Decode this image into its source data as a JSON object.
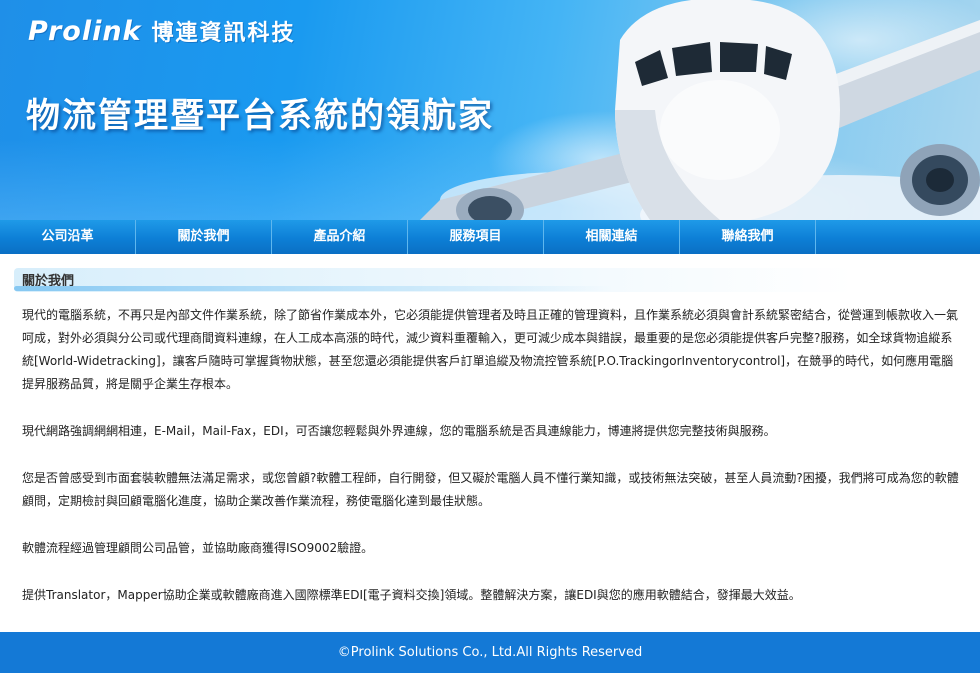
{
  "brand": {
    "logo_text": "Prolink",
    "company_name": "博連資訊科技",
    "slogan": "物流管理暨平台系統的領航家"
  },
  "nav": {
    "items": [
      "公司沿革",
      "關於我們",
      "產品介紹",
      "服務項目",
      "相關連結",
      "聯絡我們"
    ]
  },
  "section": {
    "title": "關於我們"
  },
  "content": {
    "paragraphs": [
      "現代的電腦系統，不再只是內部文件作業系統，除了節省作業成本外，它必須能提供管理者及時且正確的管理資料，且作業系統必須與會計系統緊密結合，從營運到帳款收入一氣呵成，對外必須與分公司或代理商間資料連線，在人工成本高漲的時代，減少資料重覆輸入，更可減少成本與錯誤，最重要的是您必須能提供客戶完整?服務，如全球貨物追縱系統[World-Widetracking]，讓客戶隨時可掌握貨物狀態，甚至您還必須能提供客戶訂單追縱及物流控管系統[P.O.TrackingorInventorycontrol]，在競爭的時代，如何應用電腦提昇服務品質，將是關乎企業生存根本。",
      "現代網路強調網網相連，E-Mail，Mail-Fax，EDI，可否讓您輕鬆與外界連線，您的電腦系統是否具連線能力，博連將提供您完整技術與服務。",
      "您是否曾感受到市面套裝軟體無法滿足需求，或您曾顧?軟體工程師，自行開發，但又礙於電腦人員不懂行業知識，或技術無法突破，甚至人員流動?困擾，我們將可成為您的軟體顧問，定期檢討與回顧電腦化進度，協助企業改善作業流程，務使電腦化達到最佳狀態。",
      "軟體流程經過管理顧問公司品管，並協助廠商獲得ISO9002驗證。",
      "提供Translator，Mapper協助企業或軟體廠商進入國際標準EDI[電子資料交換]領域。整體解決方案，讓EDI與您的應用軟體結合，發揮最大效益。"
    ]
  },
  "footer": {
    "copyright": "©Prolink Solutions Co., Ltd.All Rights Reserved"
  },
  "colors": {
    "nav_blue": "#0d7fd6",
    "footer_blue": "#1479d6",
    "banner_blue": "#1a9af0"
  },
  "icons": {
    "logo": "prolink-globe-logo",
    "banner_art": "airplane-image"
  }
}
